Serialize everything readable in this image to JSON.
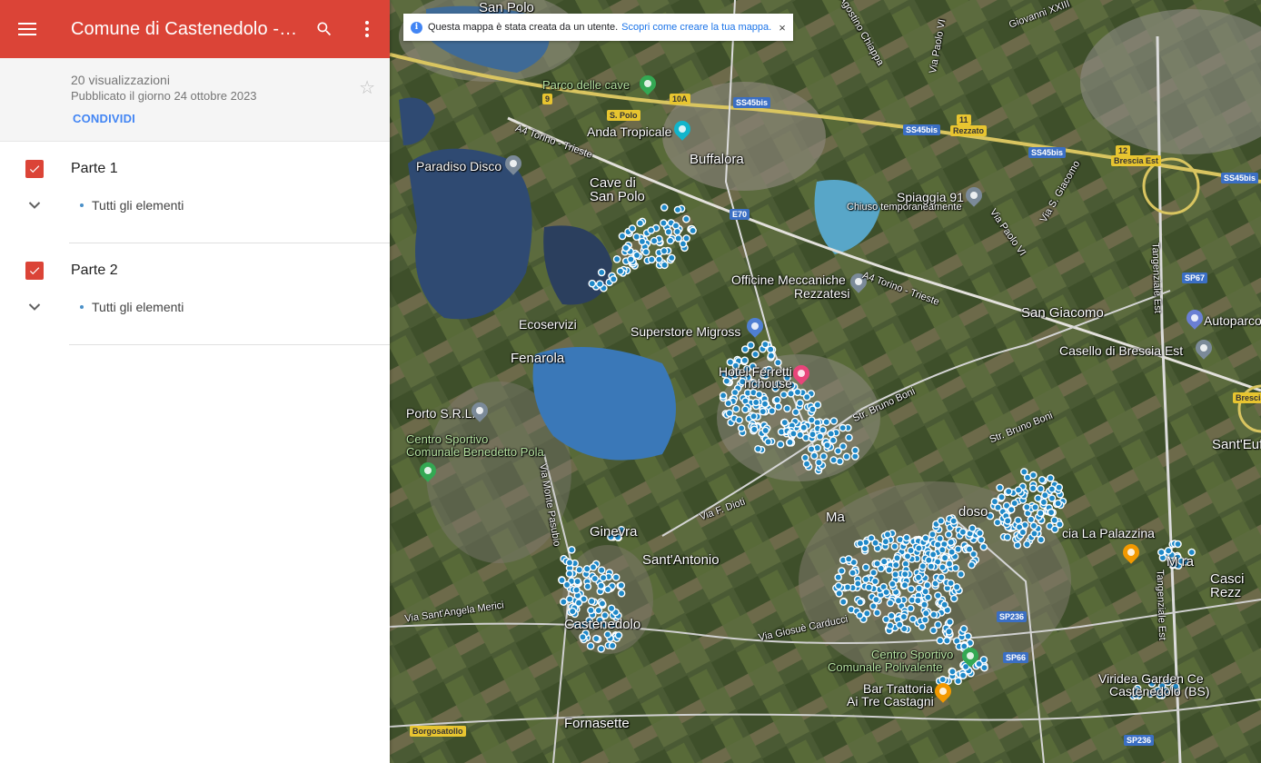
{
  "app": {
    "title": "Comune di Castenedolo - ...",
    "menu_icon": "menu-icon",
    "search_icon": "search-icon",
    "more_icon": "more-vert-icon",
    "brand_color": "#db4437"
  },
  "info": {
    "views": "20 visualizzazioni",
    "published": "Pubblicato il giorno 24 ottobre 2023",
    "share_label": "CONDIVIDI",
    "star_icon": "star-icon"
  },
  "layers": [
    {
      "name": "Parte 1",
      "checked": true,
      "item": "Tutti gli elementi"
    },
    {
      "name": "Parte 2",
      "checked": true,
      "item": "Tutti gli elementi"
    }
  ],
  "notice": {
    "text": "Questa mappa è stata creata da un utente.",
    "link": "Scopri come creare la tua mappa.",
    "close": "×"
  },
  "map": {
    "marker_color": "#1e88c8",
    "places": {
      "san_polo": "San Polo",
      "parco": "Parco delle cave",
      "anda": "Anda Tropicale",
      "buffalora": "Buffalora",
      "paradiso": "Paradiso Disco",
      "cave1": "Cave di",
      "cave2": "San Polo",
      "spiaggia": "Spiaggia 91",
      "chiuso": "Chiuso temporaneamente",
      "officine1": "Officine Meccaniche",
      "officine2": "Rezzatesi",
      "san_giacomo": "San Giacomo",
      "autoparco": "Autoparco",
      "casello": "Casello di Brescia Est",
      "ecoservizi": "Ecoservizi",
      "superstore": "Superstore Migross",
      "fenarola": "Fenarola",
      "hotel1": "Hotel Ferretti",
      "hotel2": "nchouse",
      "porto": "Porto S.R.L.",
      "centro1": "Centro Sportivo",
      "centro2": "Comunale Benedetto Pola",
      "santeufe": "Sant'Eufe",
      "ginevra": "Ginevra",
      "sant_antonio": "Sant'Antonio",
      "palazzina": "cia La Palazzina",
      "mo": "Mo",
      "castenedolo": "Castenedolo",
      "polivalente1": "Centro Sportivo",
      "polivalente2": "Comunale Polivalente",
      "bar1": "Bar Trattoria",
      "bar2": "Ai Tre Castagni",
      "viridea1": "Viridea Garden Ce",
      "viridea2": "Castenedolo (BS)",
      "fornasette": "Fornasette",
      "casci1": "Casci",
      "casci2": "Rezz",
      "mo2": "M ra",
      "doso": "doso",
      "ma": "Ma"
    },
    "roads": {
      "a4_1": "A4 Torino - Trieste",
      "a4_2": "A4 Torino - Trieste",
      "ss45_1": "SS45bis",
      "ss45_2": "SS45bis",
      "ss45_3": "SS45bis",
      "ss45_4": "SS45bis",
      "e70": "E70",
      "sp67": "SP67",
      "sp236_1": "SP236",
      "sp236_2": "SP236",
      "sp66": "SP66",
      "x10a": "10A",
      "x9": "9",
      "x11": "11",
      "x12": "12",
      "spolo": "S. Polo",
      "rezzato": "Rezzato",
      "brescia_est": "Brescia Est",
      "borgosatollo": "Borgosatollo",
      "brescia": "Brescia",
      "via_monte": "Via Monte Pasubio",
      "via_santangela": "Via Sant'Angela Merici",
      "via_giosue": "Via Giosuè Carducci",
      "via_fdioti": "Via F. Dioti",
      "str_bruno1": "Str. Bruno Boni",
      "str_bruno2": "Str. Bruno Boni",
      "tangenziale1": "Tangenziale Est",
      "tangenziale2": "Tangenziale Est",
      "via_paolo1": "Via Paolo VI",
      "via_paolo2": "Via Paolo VI",
      "via_sgiacomo": "Via S. Giacomo",
      "via_giovanni": "Giovanni XXIII",
      "via_agostino": "Via Agostino Chiappa"
    }
  }
}
